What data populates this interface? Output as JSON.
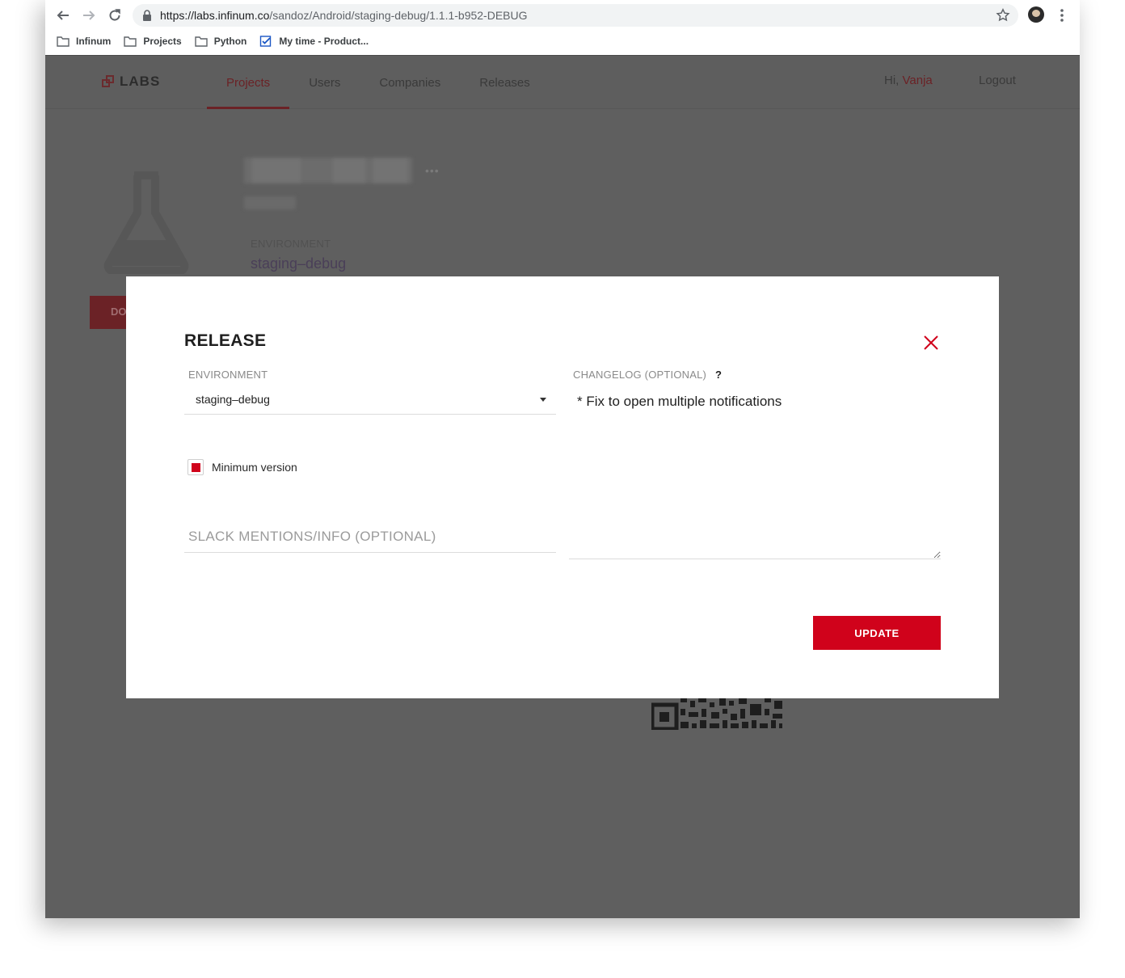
{
  "browser": {
    "url_host": "https://labs.infinum.co",
    "url_path": "/sandoz/Android/staging-debug/1.1.1-b952-DEBUG",
    "bookmarks": [
      {
        "label": "Infinum",
        "icon": "folder-icon"
      },
      {
        "label": "Projects",
        "icon": "folder-icon"
      },
      {
        "label": "Python",
        "icon": "folder-icon"
      },
      {
        "label": "My time - Product...",
        "icon": "checkbox-bookmark-icon"
      }
    ]
  },
  "app": {
    "logo_text": "LABS",
    "nav": [
      {
        "label": "Projects",
        "active": true
      },
      {
        "label": "Users",
        "active": false
      },
      {
        "label": "Companies",
        "active": false
      },
      {
        "label": "Releases",
        "active": false
      }
    ],
    "greeting_prefix": "Hi,",
    "user_name": "Vanja",
    "logout_label": "Logout",
    "environment_label": "ENVIRONMENT",
    "environment_value": "staging–debug",
    "download_label_partial": "DO",
    "more_dots": "•••"
  },
  "modal": {
    "title": "RELEASE",
    "environment_label": "ENVIRONMENT",
    "environment_value": "staging–debug",
    "changelog_label": "CHANGELOG (OPTIONAL)",
    "changelog_help": "?",
    "changelog_value": "* Fix to open multiple notifications",
    "minimum_version_label": "Minimum version",
    "minimum_version_checked": true,
    "slack_placeholder": "SLACK MENTIONS/INFO (OPTIONAL)",
    "update_label": "UPDATE"
  },
  "colors": {
    "accent": "#d0021b",
    "overlay": "#5f5f5f"
  }
}
